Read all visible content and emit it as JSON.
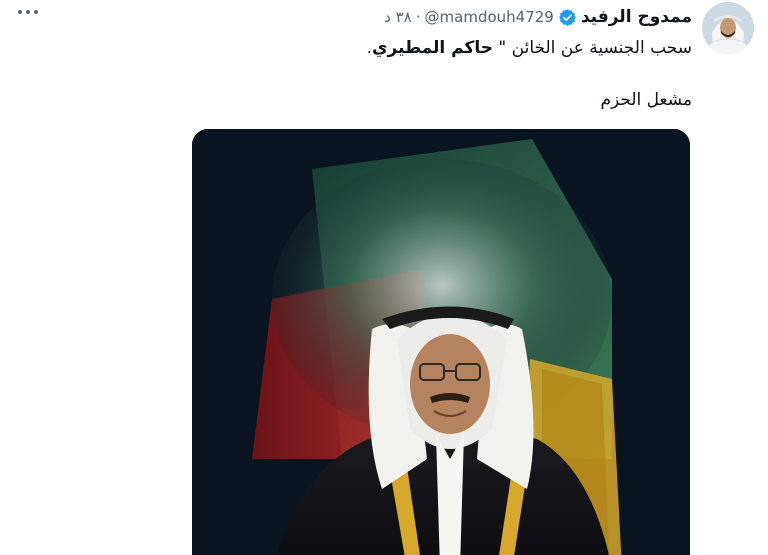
{
  "tweet": {
    "display_name": "ممدوح الرفيد",
    "handle": "@mamdouh4729",
    "separator": "·",
    "timestamp": "٣٨ د",
    "more_icon": "more-dots-icon",
    "verified_icon": "verified-badge-icon",
    "text_line1_prefix": "سحب الجنسية عن الخائن \" ",
    "text_line1_bold": "حاكم المطيري",
    "text_line1_suffix": ".",
    "text_line2": "مشعل الحزم"
  },
  "colors": {
    "text": "#0f1419",
    "muted": "#536471",
    "verified": "#1d9bf0",
    "media_bg": "#0a1420",
    "flag_green": "#3a8a5a",
    "flag_red": "#c8262a",
    "gold": "#d6a92c"
  }
}
